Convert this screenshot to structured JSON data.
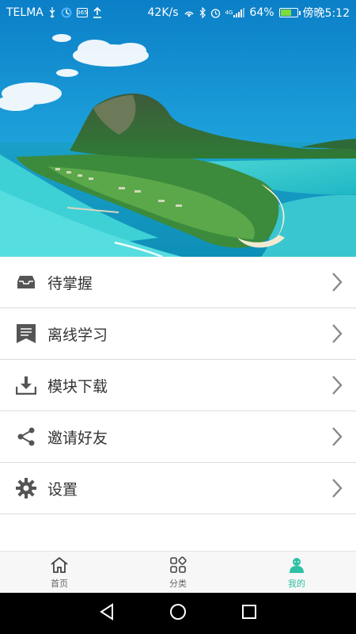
{
  "status_bar": {
    "carrier": "TELMA",
    "usb_icon": "usb-icon",
    "sync_icon": "sync-icon",
    "app365_label": "365",
    "upload_icon": "upload-icon",
    "net_speed": "42K/s",
    "network_type": "4G",
    "battery_percent": "64%",
    "battery_level": 0.64,
    "time": "傍晚5:12"
  },
  "hero": {
    "image_name": "island-aerial-photo"
  },
  "menu": {
    "items": [
      {
        "label": "待掌握",
        "icon": "inbox-icon"
      },
      {
        "label": "离线学习",
        "icon": "bookmark-list-icon"
      },
      {
        "label": "模块下载",
        "icon": "download-icon"
      },
      {
        "label": "邀请好友",
        "icon": "share-icon"
      },
      {
        "label": "设置",
        "icon": "gear-icon"
      }
    ]
  },
  "tabbar": {
    "tabs": [
      {
        "label": "首页",
        "icon": "home-icon",
        "active": false
      },
      {
        "label": "分类",
        "icon": "grid-icon",
        "active": false
      },
      {
        "label": "我的",
        "icon": "profile-icon",
        "active": true
      }
    ],
    "active_color": "#2fc0a3"
  },
  "navbar": {
    "back_icon": "back-triangle-icon",
    "home_icon": "home-circle-icon",
    "recents_icon": "recents-square-icon"
  }
}
